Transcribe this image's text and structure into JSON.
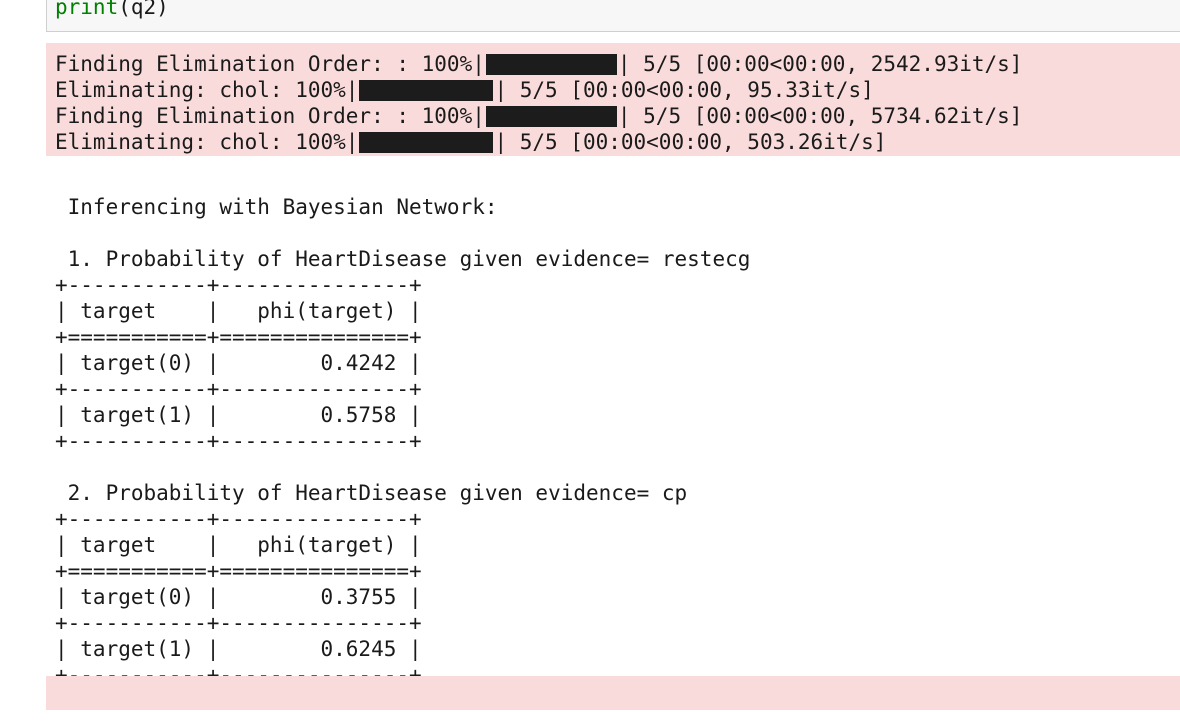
{
  "code_cell": {
    "builtin": "print",
    "rest": "(q2)"
  },
  "stderr": {
    "lines": [
      {
        "prefix": "Finding Elimination Order: : 100%|",
        "suffix": "| 5/5 [00:00<00:00, 2542.93it/s]"
      },
      {
        "prefix": "Eliminating: chol: 100%|",
        "suffix": "| 5/5 [00:00<00:00, 95.33it/s]"
      },
      {
        "prefix": "Finding Elimination Order: : 100%|",
        "suffix": "| 5/5 [00:00<00:00, 5734.62it/s]"
      },
      {
        "prefix": "Eliminating: chol: 100%|",
        "suffix": "| 5/5 [00:00<00:00, 503.26it/s]"
      }
    ]
  },
  "stdout": {
    "lines": [
      "",
      " Inferencing with Bayesian Network:",
      "",
      " 1. Probability of HeartDisease given evidence= restecg",
      "+-----------+---------------+",
      "| target    |   phi(target) |",
      "+===========+===============+",
      "| target(0) |        0.4242 |",
      "+-----------+---------------+",
      "| target(1) |        0.5758 |",
      "+-----------+---------------+",
      "",
      " 2. Probability of HeartDisease given evidence= cp",
      "+-----------+---------------+",
      "| target    |   phi(target) |",
      "+===========+===============+",
      "| target(0) |        0.3755 |",
      "+-----------+---------------+",
      "| target(1) |        0.6245 |",
      "+-----------+---------------+"
    ]
  },
  "colors": {
    "stderr_bg": "#fadbdb",
    "builtin_green": "#008000"
  }
}
